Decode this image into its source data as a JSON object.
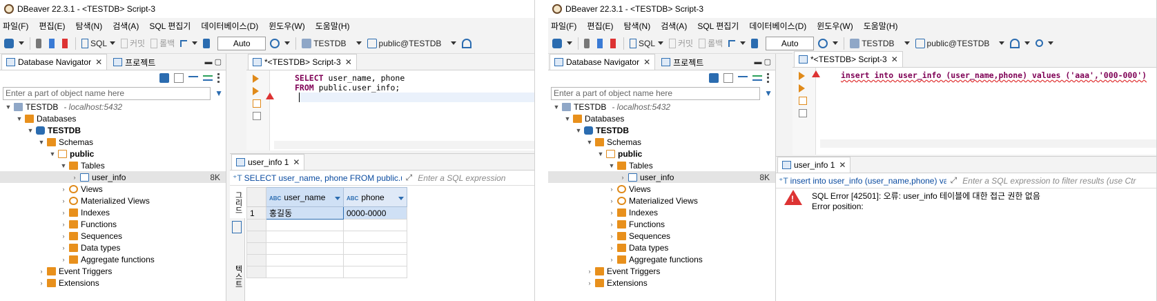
{
  "left": {
    "title": "DBeaver 22.3.1 - <TESTDB> Script-3",
    "menu": [
      "파일(F)",
      "편집(E)",
      "탐색(N)",
      "검색(A)",
      "SQL 편집기",
      "데이터베이스(D)",
      "윈도우(W)",
      "도움말(H)"
    ],
    "toolbar": {
      "sql": "SQL",
      "commit": "커밋",
      "rollback": "롤백",
      "auto": "Auto",
      "db": "TESTDB",
      "schema": "public@TESTDB"
    },
    "nav_tab": "Database Navigator",
    "project_tab": "프로젝트",
    "filter_placeholder": "Enter a part of object name here",
    "tree": {
      "conn": "TESTDB",
      "host": "- localhost:5432",
      "databases": "Databases",
      "db": "TESTDB",
      "schemas": "Schemas",
      "schema": "public",
      "tables": "Tables",
      "table": "user_info",
      "table_size": "8K",
      "views": "Views",
      "mviews": "Materialized Views",
      "indexes": "Indexes",
      "functions": "Functions",
      "sequences": "Sequences",
      "datatypes": "Data types",
      "aggregates": "Aggregate functions",
      "triggers": "Event Triggers",
      "extensions": "Extensions"
    },
    "editor_tab": "*<TESTDB> Script-3",
    "code": {
      "kw1": "SELECT",
      "line1": " user_name, phone",
      "kw2": "FROM",
      "line2": " public.user_info;"
    },
    "result_tab": "user_info 1",
    "result_query": "SELECT user_name, phone FROM public.user",
    "result_filter_placeholder": "Enter a SQL expression",
    "vtab_grid": "그리드",
    "vtab_text": "텍스트",
    "columns": [
      "user_name",
      "phone"
    ],
    "row_num": "1",
    "row": [
      "홍길동",
      "0000-0000"
    ]
  },
  "right": {
    "title": "DBeaver 22.3.1 - <TESTDB> Script-3",
    "menu": [
      "파일(F)",
      "편집(E)",
      "탐색(N)",
      "검색(A)",
      "SQL 편집기",
      "데이터베이스(D)",
      "윈도우(W)",
      "도움말(H)"
    ],
    "toolbar": {
      "sql": "SQL",
      "commit": "커밋",
      "rollback": "롤백",
      "auto": "Auto",
      "db": "TESTDB",
      "schema": "public@TESTDB"
    },
    "nav_tab": "Database Navigator",
    "project_tab": "프로젝트",
    "filter_placeholder": "Enter a part of object name here",
    "tree": {
      "conn": "TESTDB",
      "host": "- localhost:5432",
      "databases": "Databases",
      "db": "TESTDB",
      "schemas": "Schemas",
      "schema": "public",
      "tables": "Tables",
      "table": "user_info",
      "table_size": "8K",
      "views": "Views",
      "mviews": "Materialized Views",
      "indexes": "Indexes",
      "functions": "Functions",
      "sequences": "Sequences",
      "datatypes": "Data types",
      "aggregates": "Aggregate functions",
      "triggers": "Event Triggers",
      "extensions": "Extensions"
    },
    "editor_tab": "*<TESTDB> Script-3",
    "code": {
      "line1": "insert into user_info (user_name,phone) values ('aaa','000-000')"
    },
    "result_tab": "user_info 1",
    "result_query": "insert into user_info (user_name,phone) va",
    "result_filter_placeholder": "Enter a SQL expression to filter results (use Ctr",
    "error_line1": "SQL Error [42501]: 오류: user_info 테이블에 대한 접근 권한 없음",
    "error_line2": "Error position:"
  }
}
